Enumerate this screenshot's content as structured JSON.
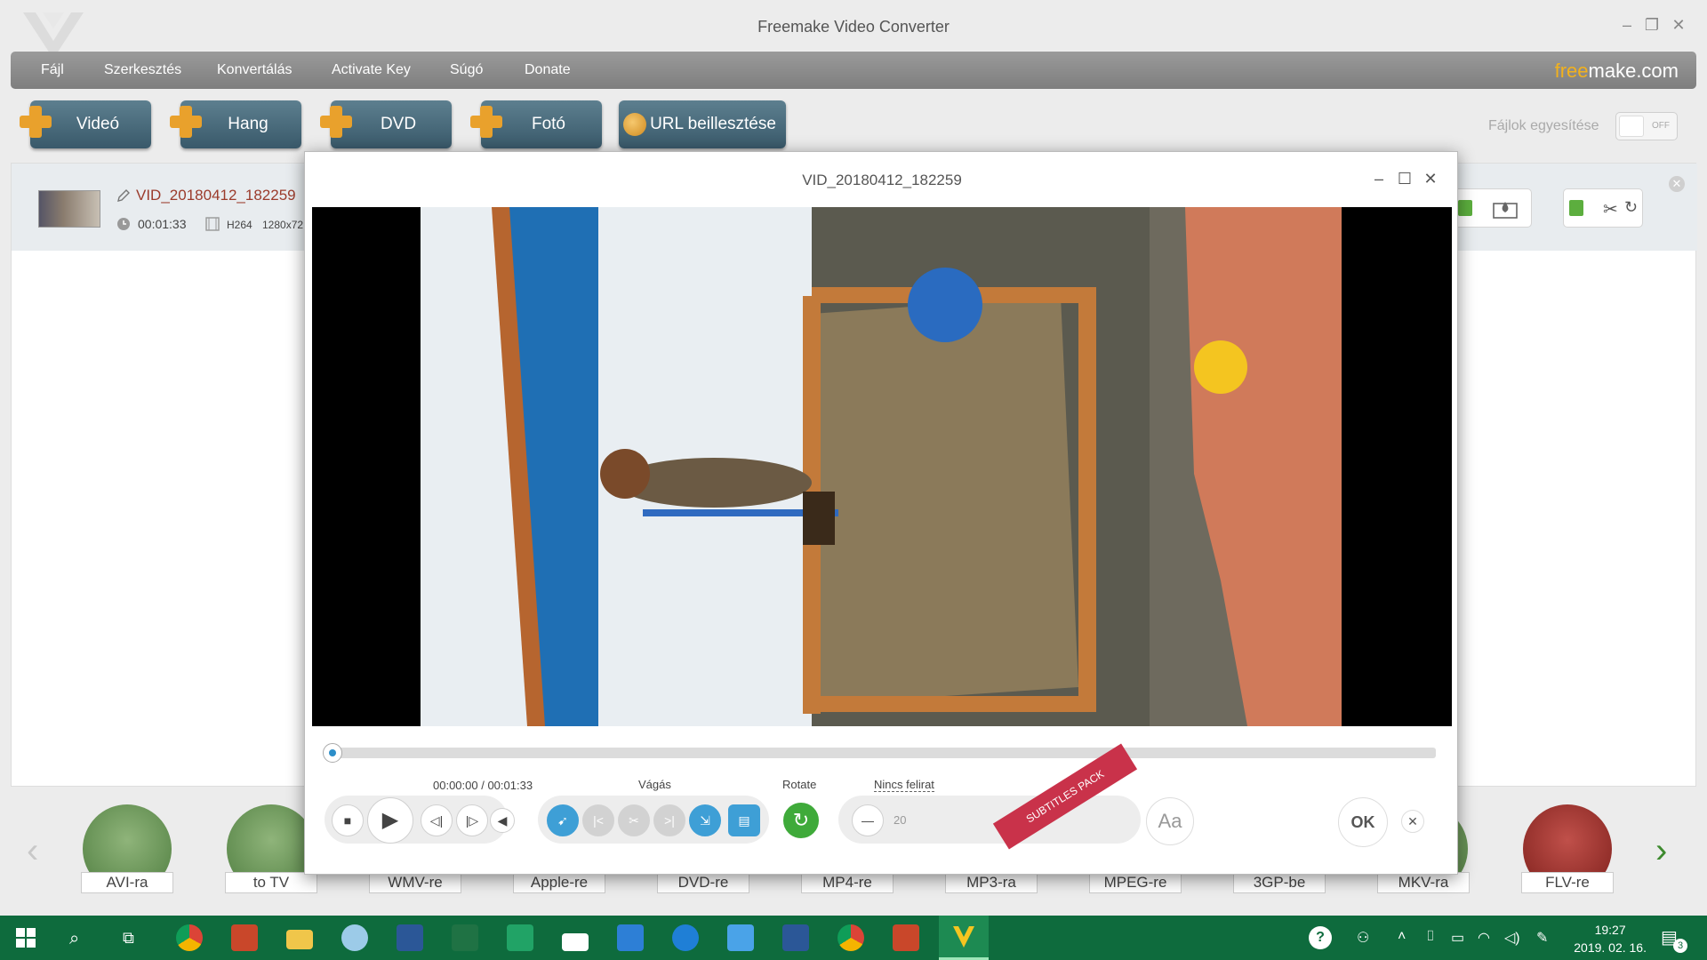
{
  "window": {
    "title": "Freemake Video Converter",
    "controls": [
      "–",
      "❐",
      "✕"
    ]
  },
  "menu": {
    "items": [
      "Fájl",
      "Szerkesztés",
      "Konvertálás",
      "Activate Key",
      "Súgó",
      "Donate"
    ],
    "brand_part1": "free",
    "brand_part2": "make.com"
  },
  "toolbar": {
    "buttons": [
      "Videó",
      "Hang",
      "DVD",
      "Fotó"
    ],
    "url_button": "URL beillesztése",
    "merge_label": "Fájlok egyesítése",
    "merge_state": "OFF"
  },
  "file": {
    "name": "VID_20180412_182259",
    "duration": "00:01:33",
    "codec": "H264",
    "resolution": "1280x72"
  },
  "formats": [
    "AVI-ra",
    "to TV",
    "WMV-re",
    "Apple-re",
    "DVD-re",
    "MP4-re",
    "MP3-ra",
    "MPEG-re",
    "3GP-be",
    "MKV-ra",
    "FLV-re"
  ],
  "dialog": {
    "title": "VID_20180412_182259",
    "time": "00:00:00 / 00:01:33",
    "cut_label": "Vágás",
    "rotate_label": "Rotate",
    "subtitle_label": "Nincs felirat",
    "subtitle_size": "20",
    "ribbon": "SUBTITLES PACK",
    "font_button": "Aa",
    "ok": "OK",
    "progress": 0.0
  },
  "taskbar": {
    "time": "19:27",
    "date": "2019. 02. 16.",
    "notification_count": "3"
  }
}
